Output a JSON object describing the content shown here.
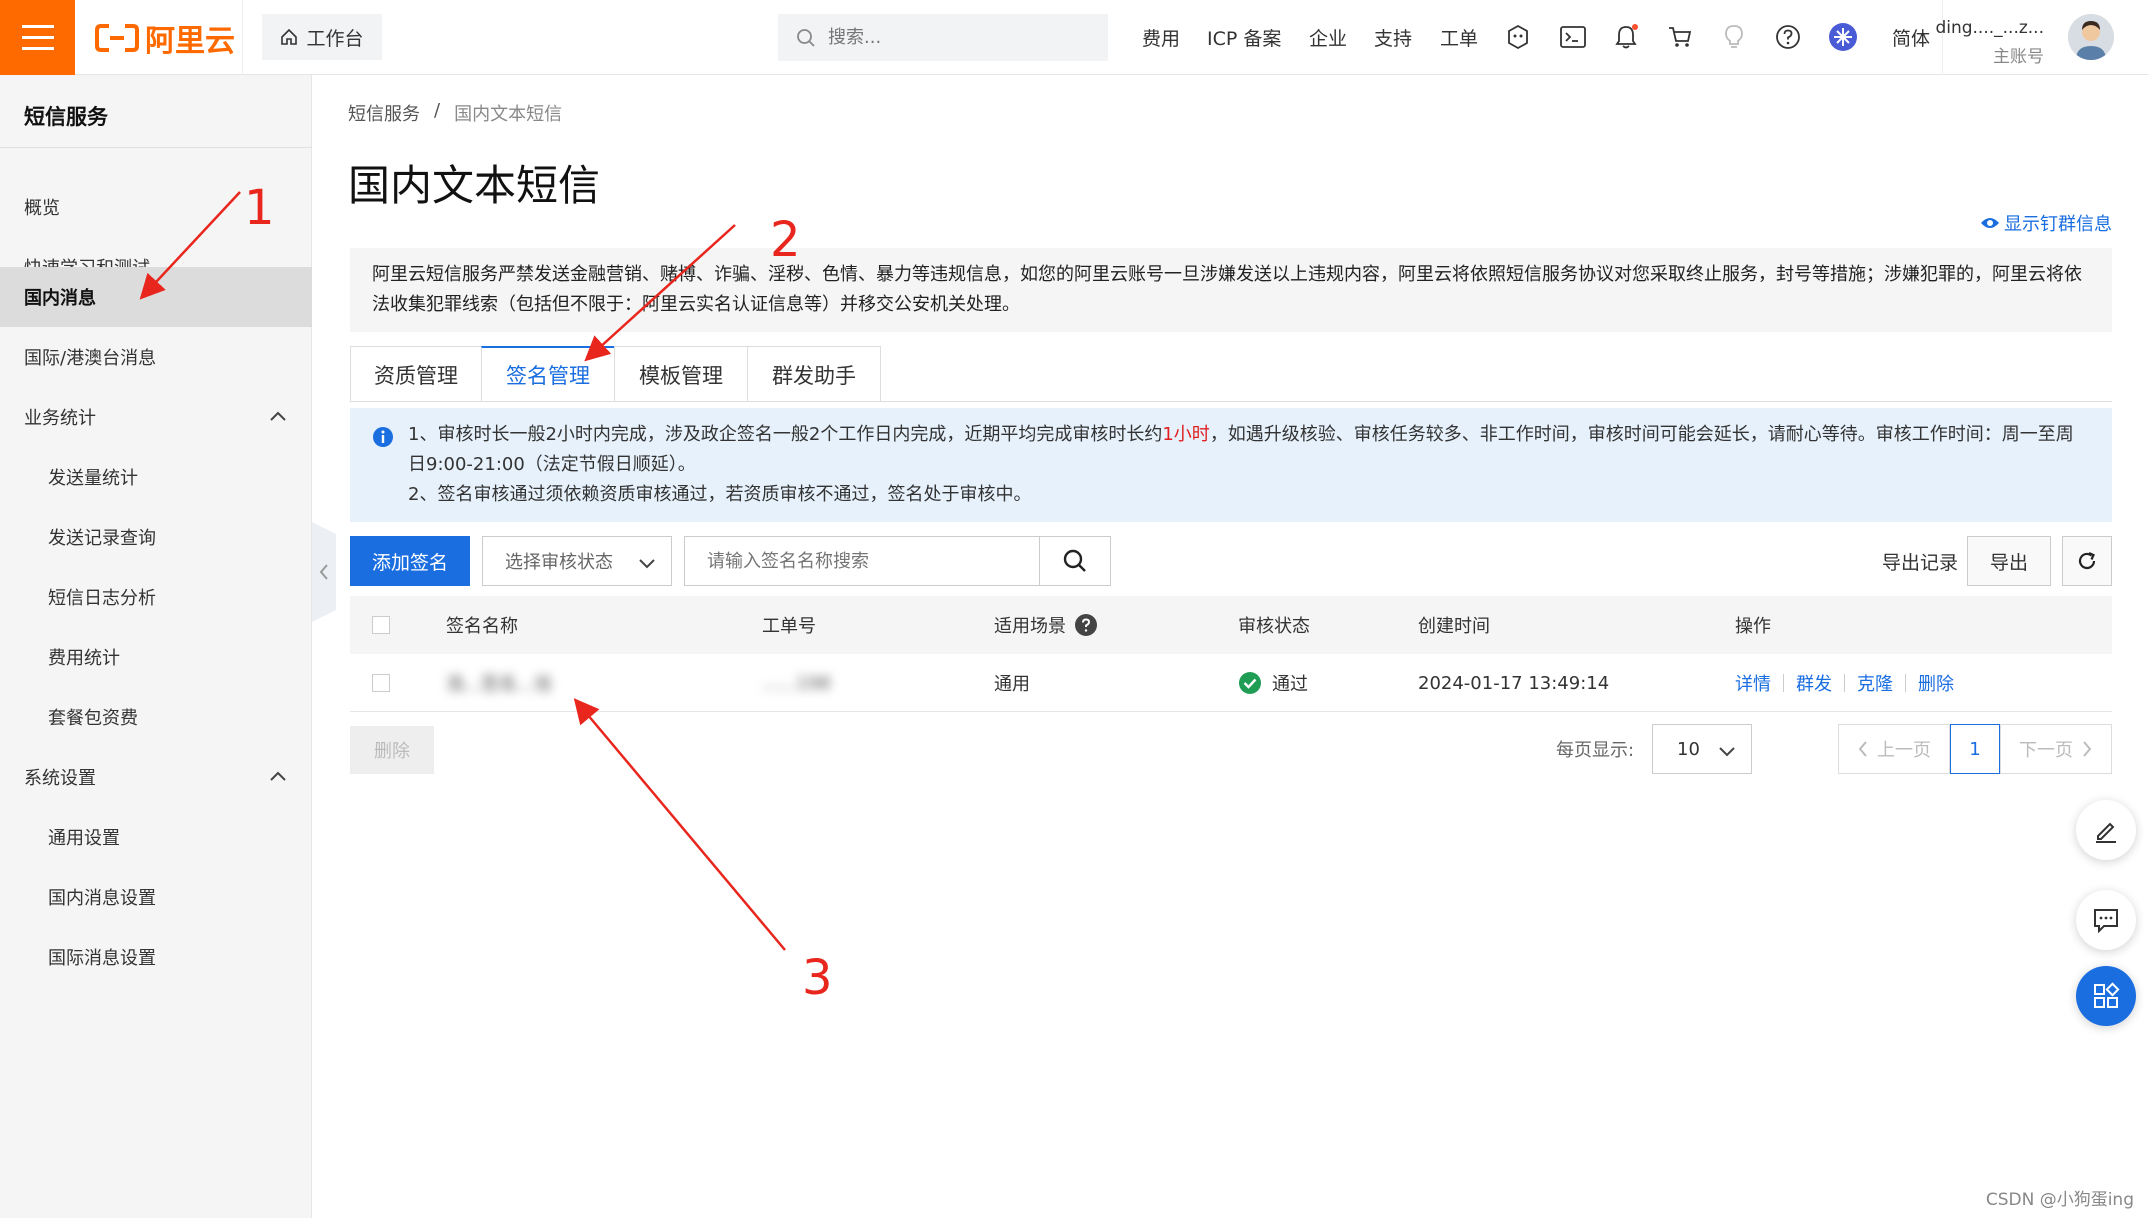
{
  "topbar": {
    "logo_text": "阿里云",
    "workbench_label": "工作台",
    "search_placeholder": "搜索...",
    "nav": [
      "费用",
      "ICP 备案",
      "企业",
      "支持",
      "工单"
    ],
    "lang_label": "简体",
    "user_name": "ding...._...z...",
    "user_role": "主账号"
  },
  "sidebar": {
    "title": "短信服务",
    "items": [
      {
        "label": "概览"
      },
      {
        "label": "快速学习和测试"
      },
      {
        "label": "国内消息"
      },
      {
        "label": "国际/港澳台消息"
      },
      {
        "label": "业务统计"
      },
      {
        "label": "发送量统计"
      },
      {
        "label": "发送记录查询"
      },
      {
        "label": "短信日志分析"
      },
      {
        "label": "费用统计"
      },
      {
        "label": "套餐包资费"
      },
      {
        "label": "系统设置"
      },
      {
        "label": "通用设置"
      },
      {
        "label": "国内消息设置"
      },
      {
        "label": "国际消息设置"
      }
    ]
  },
  "main": {
    "breadcrumb": [
      "短信服务",
      "/",
      "国内文本短信"
    ],
    "title": "国内文本短信",
    "show_group_link": "显示钉群信息",
    "warning_text": "阿里云短信服务严禁发送金融营销、赌博、诈骗、淫秽、色情、暴力等违规信息，如您的阿里云账号一旦涉嫌发送以上违规内容，阿里云将依照短信服务协议对您采取终止服务，封号等措施；涉嫌犯罪的，阿里云将依法收集犯罪线索（包括但不限于：阿里云实名认证信息等）并移交公安机关处理。",
    "tabs": [
      "资质管理",
      "签名管理",
      "模板管理",
      "群发助手"
    ],
    "info": {
      "line1_pre": "1、审核时长一般2小时内完成，涉及政企签名一般2个工作日内完成，近期平均完成审核时长约",
      "line1_highlight": "1小时",
      "line1_post": "，如遇升级核验、审核任务较多、非工作时间，审核时间可能会延长，请耐心等待。审核工作时间：周一至周",
      "line1b": "日9:00-21:00（法定节假日顺延）。",
      "line2": "2、签名审核通过须依赖资质审核通过，若资质审核不通过，签名处于审核中。"
    },
    "toolbar": {
      "add_button": "添加签名",
      "status_select": "选择审核状态",
      "search_placeholder": "请输入签名名称搜索",
      "export_records": "导出记录",
      "export_button": "导出"
    },
    "table": {
      "headers": [
        "签名名称",
        "工单号",
        "适用场景",
        "审核状态",
        "创建时间",
        "操作"
      ],
      "rows": [
        {
          "name": "浩...签名...信",
          "ticket": "......198",
          "scene": "通用",
          "status": "通过",
          "created": "2024-01-17 13:49:14",
          "ops": [
            "详情",
            "群发",
            "克隆",
            "删除"
          ]
        }
      ]
    },
    "bulk_delete": "删除",
    "pager": {
      "per_page_label": "每页显示:",
      "per_page_value": "10",
      "prev": "上一页",
      "current": "1",
      "next": "下一页"
    }
  },
  "annotations": [
    "1",
    "2",
    "3"
  ],
  "watermark": "CSDN @小狗蛋ing",
  "colors": {
    "brand": "#ff6a00",
    "primary": "#1a6ee0",
    "annotation": "#e8261d",
    "success": "#1f9d55"
  }
}
